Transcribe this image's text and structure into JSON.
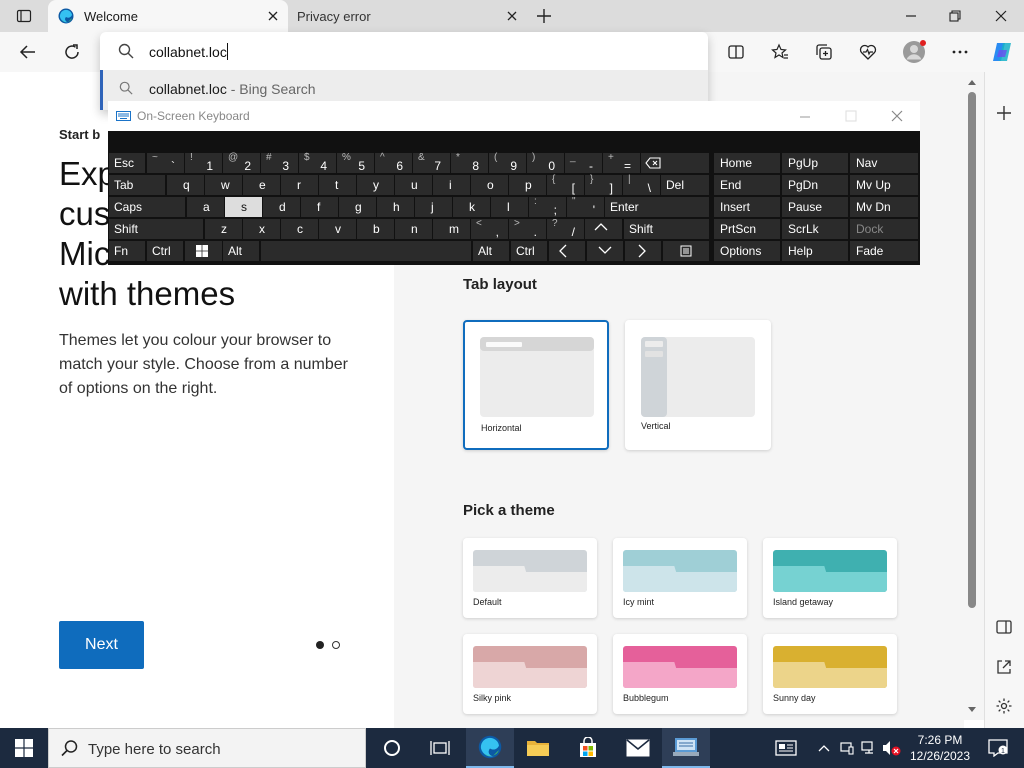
{
  "browser": {
    "tabs": [
      {
        "title": "Welcome",
        "active": true
      },
      {
        "title": "Privacy error",
        "active": false
      }
    ],
    "address_input": "collabnet.loc",
    "suggestion": {
      "query": "collabnet.loc",
      "source": " - Bing Search"
    }
  },
  "welcome": {
    "eyebrow": "Start b",
    "heading_lines": [
      "Exp",
      "cus",
      "Micr",
      "with themes"
    ],
    "description": "Themes let you colour your browser to match your style. Choose from a number of options on the right.",
    "next_label": "Next",
    "pager": {
      "current": 1,
      "total": 2
    }
  },
  "tab_layout": {
    "title": "Tab layout",
    "options": [
      {
        "label": "Horizontal",
        "selected": true
      },
      {
        "label": "Vertical",
        "selected": false
      }
    ]
  },
  "themes": {
    "title": "Pick a theme",
    "items": [
      {
        "label": "Default",
        "back": "#cfd4d8",
        "front": "#ececec"
      },
      {
        "label": "Icy mint",
        "back": "#9fcfd6",
        "front": "#cde4ea"
      },
      {
        "label": "Island getaway",
        "back": "#3fb0b0",
        "front": "#76d2d2"
      },
      {
        "label": "Silky pink",
        "back": "#d8a8a8",
        "front": "#eed4d4"
      },
      {
        "label": "Bubblegum",
        "back": "#e5609a",
        "front": "#f4a6c8"
      },
      {
        "label": "Sunny day",
        "back": "#d9b030",
        "front": "#ecd48a"
      }
    ]
  },
  "osk": {
    "title": "On-Screen Keyboard",
    "active_key": "s",
    "row1": {
      "esc": "Esc",
      "keys": [
        [
          "~",
          "`"
        ],
        [
          "!",
          "1"
        ],
        [
          "@",
          "2"
        ],
        [
          "#",
          "3"
        ],
        [
          "$",
          "4"
        ],
        [
          "%",
          "5"
        ],
        [
          "^",
          "6"
        ],
        [
          "&",
          "7"
        ],
        [
          "*",
          "8"
        ],
        [
          "(",
          "9"
        ],
        [
          ")",
          "0"
        ],
        [
          "_",
          "-"
        ],
        [
          "+",
          "="
        ]
      ]
    },
    "row2": {
      "tab": "Tab",
      "keys": [
        "q",
        "w",
        "e",
        "r",
        "t",
        "y",
        "u",
        "i",
        "o",
        "p"
      ],
      "brackets": [
        [
          "{",
          "["
        ],
        [
          "}",
          "]"
        ],
        [
          "|",
          "\\"
        ]
      ],
      "del": "Del"
    },
    "row3": {
      "caps": "Caps",
      "keys": [
        "a",
        "s",
        "d",
        "f",
        "g",
        "h",
        "j",
        "k",
        "l"
      ],
      "punct": [
        [
          ":",
          ";"
        ],
        [
          "\"",
          "'"
        ]
      ],
      "enter": "Enter"
    },
    "row4": {
      "shift": "Shift",
      "keys": [
        "z",
        "x",
        "c",
        "v",
        "b",
        "n",
        "m"
      ],
      "punct": [
        [
          "<",
          ","
        ],
        [
          ">",
          "."
        ],
        [
          "?",
          "/"
        ]
      ],
      "shift_r": "Shift"
    },
    "row5": {
      "fn": "Fn",
      "ctrl": "Ctrl",
      "alt": "Alt",
      "alt_r": "Alt",
      "ctrl_r": "Ctrl"
    },
    "nav": [
      [
        "Home",
        "PgUp",
        "Nav"
      ],
      [
        "End",
        "PgDn",
        "Mv Up"
      ],
      [
        "Insert",
        "Pause",
        "Mv Dn"
      ],
      [
        "PrtScn",
        "ScrLk",
        "Dock"
      ],
      [
        "Options",
        "Help",
        "Fade"
      ]
    ]
  },
  "taskbar": {
    "search_placeholder": "Type here to search",
    "time": "7:26 PM",
    "date": "12/26/2023"
  }
}
